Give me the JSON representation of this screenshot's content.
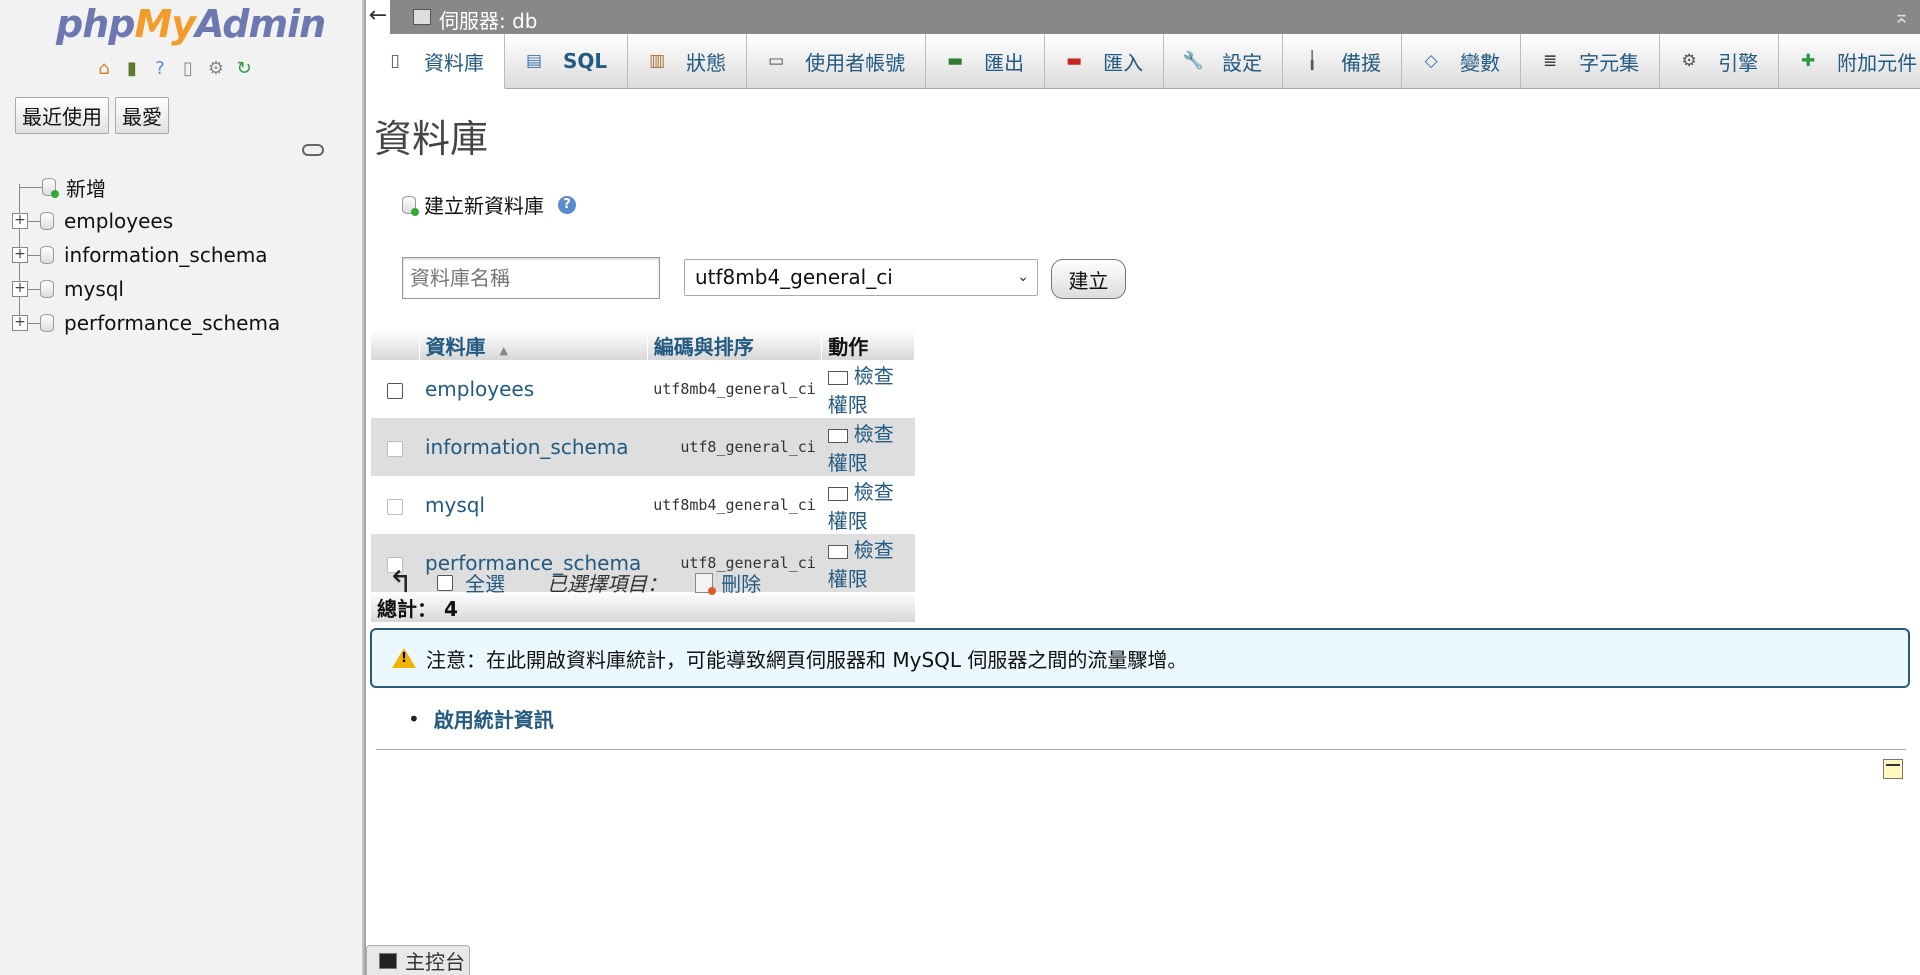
{
  "logo": {
    "php": "php",
    "my": "My",
    "admin": "Admin"
  },
  "nav": {
    "icons": [
      "home-icon",
      "logout-icon",
      "help-icon",
      "docs-icon",
      "settings-icon",
      "reload-icon"
    ],
    "recent_label": "最近使用",
    "favorites_label": "最愛",
    "tree": {
      "new_label": "新增",
      "databases": [
        "employees",
        "information_schema",
        "mysql",
        "performance_schema"
      ]
    }
  },
  "serverbar": {
    "title": "伺服器: db",
    "back_label": "←",
    "collapse_label": "⌅"
  },
  "tabs": [
    {
      "label": "資料庫",
      "icon": "database-icon",
      "active": true
    },
    {
      "label": "SQL",
      "icon": "sql-icon"
    },
    {
      "label": "狀態",
      "icon": "status-icon"
    },
    {
      "label": "使用者帳號",
      "icon": "users-icon"
    },
    {
      "label": "匯出",
      "icon": "export-icon"
    },
    {
      "label": "匯入",
      "icon": "import-icon"
    },
    {
      "label": "設定",
      "icon": "wrench-icon"
    },
    {
      "label": "備援",
      "icon": "replication-icon"
    },
    {
      "label": "變數",
      "icon": "variables-icon"
    },
    {
      "label": "字元集",
      "icon": "charset-icon"
    },
    {
      "label": "引擎",
      "icon": "engine-icon"
    },
    {
      "label": "附加元件",
      "icon": "plugin-icon"
    }
  ],
  "main": {
    "title": "資料庫",
    "create": {
      "heading": "建立新資料庫",
      "name_placeholder": "資料庫名稱",
      "collation_value": "utf8mb4_general_ci",
      "create_button": "建立"
    },
    "table": {
      "headers": {
        "database": "資料庫",
        "collation": "編碼與排序",
        "action": "動作"
      },
      "rows": [
        {
          "name": "employees",
          "collation": "utf8mb4_general_ci",
          "action": "檢查權限"
        },
        {
          "name": "information_schema",
          "collation": "utf8_general_ci",
          "action": "檢查權限"
        },
        {
          "name": "mysql",
          "collation": "utf8mb4_general_ci",
          "action": "檢查權限"
        },
        {
          "name": "performance_schema",
          "collation": "utf8_general_ci",
          "action": "檢查權限"
        }
      ],
      "total_label": "總計：",
      "total_value": "4"
    },
    "selected_bar": {
      "select_all": "全選",
      "with_selected": "已選擇項目：",
      "delete": "刪除"
    },
    "notice": "注意：在此開啟資料庫統計，可能導致網頁伺服器和 MySQL 伺服器之間的流量驟增。",
    "enable_stats": "啟用統計資訊"
  },
  "console": {
    "label": "主控台"
  },
  "colors": {
    "link": "#235a81",
    "notice_border": "#2a5a7a",
    "notice_bg": "#ebf8ff"
  }
}
